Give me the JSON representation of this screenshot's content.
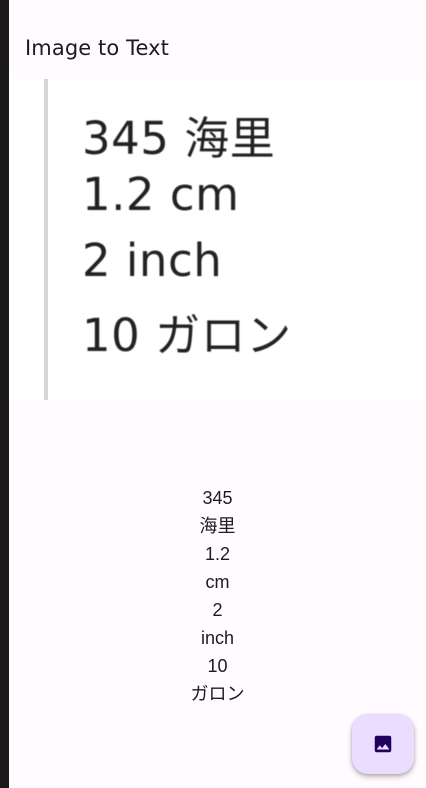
{
  "app_bar": {
    "title": "Image to Text"
  },
  "source_image": {
    "lines": [
      "345 海里",
      "1.2 cm",
      "2 inch",
      "10 ガロン"
    ]
  },
  "result": {
    "lines": [
      "345",
      "海里",
      "1.2",
      "cm",
      "2",
      "inch",
      "10",
      "ガロン"
    ]
  },
  "fab": {
    "icon": "image-icon"
  },
  "colors": {
    "background": "#fffbfe",
    "fab_background": "#eaddff",
    "fab_icon": "#21005d",
    "text": "#1c1b1f"
  }
}
